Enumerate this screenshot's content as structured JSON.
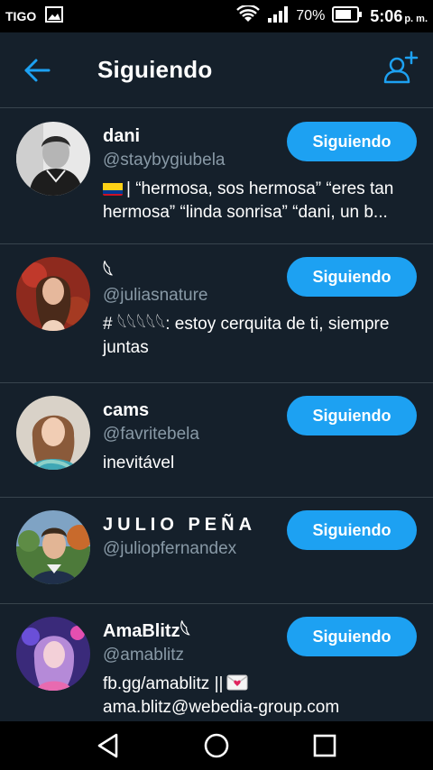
{
  "status_bar": {
    "carrier": "TIGO",
    "battery": "70%",
    "time": "5:06",
    "ampm": "p. m."
  },
  "app_bar": {
    "title": "Siguiendo"
  },
  "colors": {
    "background": "#15202b",
    "accent": "#1da1f2",
    "secondary_text": "#8899a6",
    "divider": "#38444d"
  },
  "users": [
    {
      "name": "dani",
      "handle": "@staybygiubela",
      "bio_prefix": "| “hermosa, sos hermosa” “eres tan hermosa” “linda sonrisa” “dani, un b...",
      "bio_icon": "colombia-flag-icon",
      "button": "Siguiendo"
    },
    {
      "name": "𓆩",
      "handle": "@juliasnature",
      "bio": "# 𓆩𓆩𓆩𓆩𓆩: estoy cerquita de ti, siempre juntas",
      "button": "Siguiendo"
    },
    {
      "name": "cams",
      "handle": "@favritebela",
      "bio": "inevitável",
      "button": "Siguiendo"
    },
    {
      "name": "JULIO PEÑA",
      "handle": "@juliopfernandex",
      "bio": "",
      "button": "Siguiendo"
    },
    {
      "name": "AmaBlitz𓆩",
      "handle": "@amablitz",
      "bio_line1": "fb.gg/amablitz ||",
      "bio_line2": "ama.blitz@webedia-group.com",
      "bio_icon": "envelope-icon",
      "button": "Siguiendo"
    }
  ],
  "nav_bar": {
    "icons": [
      "back-triangle-icon",
      "home-circle-icon",
      "recents-square-icon"
    ]
  }
}
